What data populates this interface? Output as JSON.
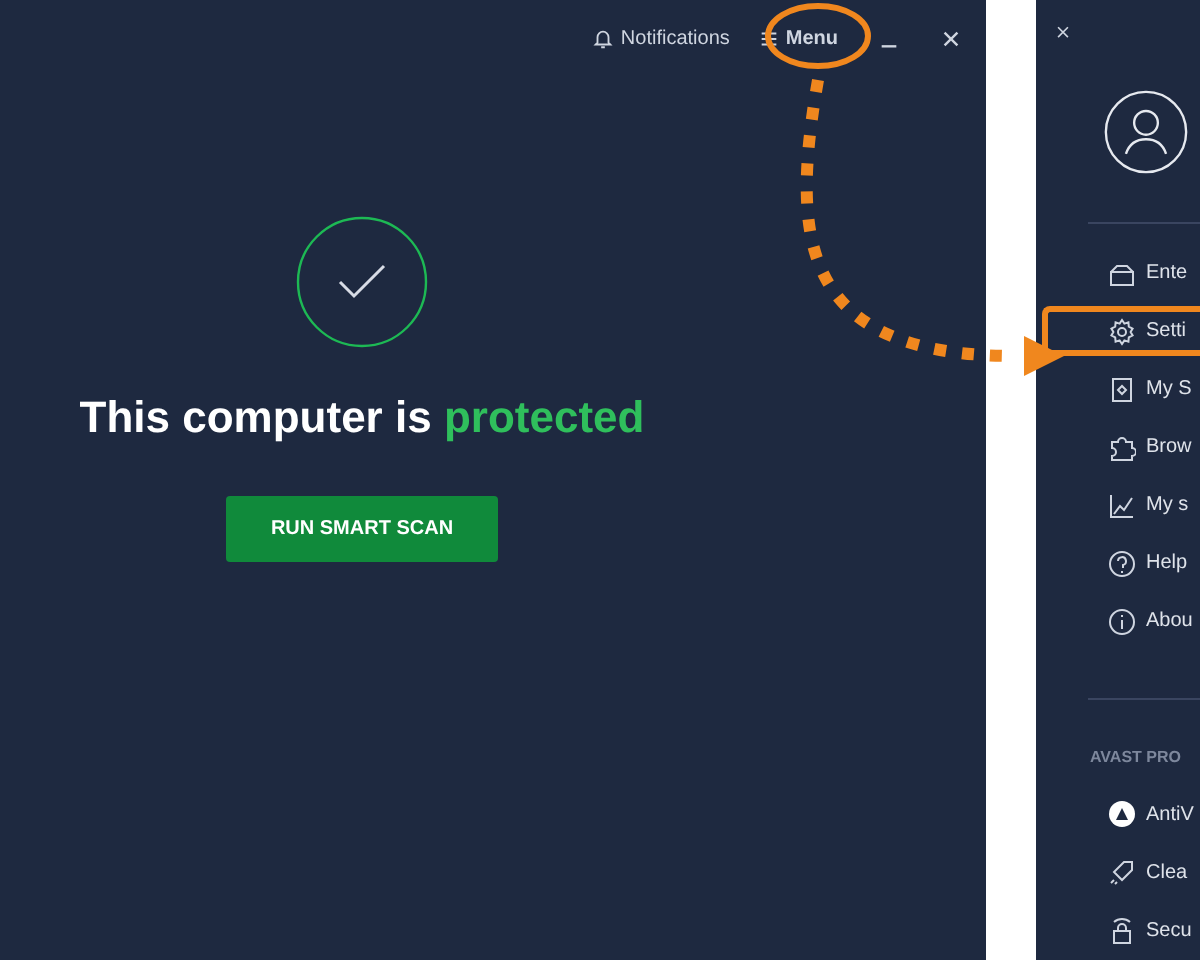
{
  "main_window": {
    "top_bar": [
      {
        "kind": "notifications",
        "label": "Notifications",
        "highlighted": false
      },
      {
        "kind": "menu",
        "label": "Menu",
        "highlighted": true
      }
    ],
    "status": {
      "text": "This computer is **protected**"
    },
    "scan_button": {
      "label": "RUN SMART SCAN"
    }
  },
  "menu_panel": {
    "items": [
      {
        "label": "Ente",
        "highlighted": false
      },
      {
        "label": "Setti",
        "highlighted": true
      },
      {
        "label": "My S",
        "highlighted": false
      },
      {
        "label": "Brow",
        "highlighted": false
      },
      {
        "label": "My s",
        "highlighted": false
      },
      {
        "label": "Help",
        "highlighted": false
      },
      {
        "label": "Abou",
        "highlighted": false
      }
    ],
    "section_title": "AVAST PRO",
    "products": [
      {
        "label": "AntiV"
      },
      {
        "label": "Clea"
      },
      {
        "label": "Secu"
      }
    ]
  }
}
